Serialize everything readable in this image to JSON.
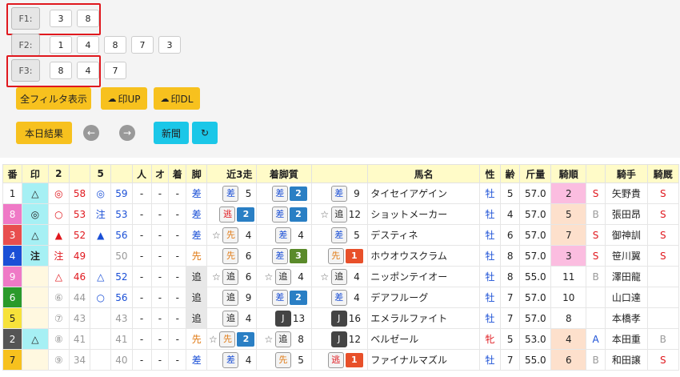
{
  "filters": [
    {
      "label": "F1:",
      "nums": [
        "3",
        "8"
      ]
    },
    {
      "label": "F2:",
      "nums": [
        "1",
        "4",
        "8",
        "7",
        "3"
      ]
    },
    {
      "label": "F3:",
      "nums": [
        "8",
        "4",
        "7"
      ]
    }
  ],
  "buttons": {
    "all_filter": "全フィルタ表示",
    "mark_up": "印UP",
    "mark_dl": "印DL",
    "today": "本日結果",
    "prev": "←",
    "next": "→",
    "paper": "新聞",
    "refresh": "↻"
  },
  "columns": [
    "番",
    "印",
    "2",
    "",
    "5",
    "",
    "人",
    "オ",
    "着",
    "脚",
    "近3走",
    "着脚質",
    "",
    "馬名",
    "性",
    "齢",
    "斤量",
    "騎順",
    "",
    "騎手",
    "騎厩"
  ],
  "rows": [
    {
      "num": "1",
      "numbg": "#ffffff",
      "numfg": "#222",
      "mark": "△",
      "markbg": "#a6f0f4",
      "m2": "◎",
      "m2c": "red",
      "v2": "58",
      "v2c": "red",
      "m5": "◎",
      "m5c": "blue",
      "v5": "59",
      "v5c": "blue",
      "ninki": "-",
      "odds": "-",
      "chaku": "-",
      "kyaku": "差",
      "kyc": "blue",
      "kybg": "",
      "races": [
        {
          "s": "",
          "k": "差",
          "n": "5",
          "b": ""
        },
        {
          "s": "",
          "k": "差",
          "n": "2",
          "b": "#2a7fc4"
        },
        {
          "s": "",
          "k": "差",
          "n": "9",
          "b": ""
        }
      ],
      "name": "タイセイアゲイン",
      "sex": "牡",
      "sexc": "blue",
      "age": "5",
      "weight": "57.0",
      "jorder": "2",
      "jobg": "#fbbde0",
      "jmark": "S",
      "jmc": "red",
      "jockey": "矢野貴",
      "jk": "S",
      "jkc": "red"
    },
    {
      "num": "8",
      "numbg": "#ef79c6",
      "numfg": "#fff",
      "mark": "◎",
      "markbg": "#a6f0f4",
      "m2": "○",
      "m2c": "red",
      "v2": "53",
      "v2c": "red",
      "m5": "注",
      "m5c": "blue",
      "v5": "53",
      "v5c": "blue",
      "ninki": "-",
      "odds": "-",
      "chaku": "-",
      "kyaku": "差",
      "kyc": "blue",
      "kybg": "",
      "races": [
        {
          "s": "",
          "k": "逃",
          "n": "2",
          "b": "#2a7fc4",
          "kc": "red"
        },
        {
          "s": "",
          "k": "差",
          "n": "2",
          "b": "#2a7fc4"
        },
        {
          "s": "☆",
          "k": "追",
          "n": "12",
          "b": ""
        }
      ],
      "name": "ショットメーカー",
      "sex": "牡",
      "sexc": "blue",
      "age": "4",
      "weight": "57.0",
      "jorder": "5",
      "jobg": "#fde0cc",
      "jmark": "B",
      "jmc": "gray",
      "jockey": "張田昂",
      "jk": "S",
      "jkc": "red"
    },
    {
      "num": "3",
      "numbg": "#e84e4e",
      "numfg": "#fff",
      "mark": "△",
      "markbg": "#a6f0f4",
      "m2": "▲",
      "m2c": "red",
      "v2": "52",
      "v2c": "red",
      "m5": "▲",
      "m5c": "blue",
      "v5": "56",
      "v5c": "blue",
      "ninki": "-",
      "odds": "-",
      "chaku": "-",
      "kyaku": "差",
      "kyc": "blue",
      "kybg": "",
      "races": [
        {
          "s": "☆",
          "k": "先",
          "n": "4",
          "b": "",
          "kc": "org"
        },
        {
          "s": "",
          "k": "差",
          "n": "4",
          "b": ""
        },
        {
          "s": "",
          "k": "差",
          "n": "5",
          "b": ""
        }
      ],
      "name": "デスティネ",
      "sex": "牡",
      "sexc": "blue",
      "age": "6",
      "weight": "57.0",
      "jorder": "7",
      "jobg": "#fde0cc",
      "jmark": "S",
      "jmc": "red",
      "jockey": "御神訓",
      "jk": "S",
      "jkc": "red"
    },
    {
      "num": "4",
      "numbg": "#1a4fd6",
      "numfg": "#fff",
      "mark": "注",
      "markbg": "#a6f0f4",
      "m2": "注",
      "m2c": "red",
      "v2": "49",
      "v2c": "red",
      "m5": "",
      "m5c": "gray",
      "v5": "50",
      "v5c": "gray",
      "ninki": "-",
      "odds": "-",
      "chaku": "-",
      "kyaku": "先",
      "kyc": "org",
      "kybg": "",
      "races": [
        {
          "s": "",
          "k": "先",
          "n": "6",
          "b": "",
          "kc": "org"
        },
        {
          "s": "",
          "k": "差",
          "n": "3",
          "b": "#5a8a2a"
        },
        {
          "s": "",
          "k": "先",
          "n": "1",
          "b": "#e8502a",
          "kc": "org"
        }
      ],
      "name": "ホウオウスクラム",
      "sex": "牡",
      "sexc": "blue",
      "age": "8",
      "weight": "57.0",
      "jorder": "3",
      "jobg": "#fbbde0",
      "jmark": "S",
      "jmc": "red",
      "jockey": "笹川翼",
      "jk": "S",
      "jkc": "red"
    },
    {
      "num": "9",
      "numbg": "#ef79c6",
      "numfg": "#fff",
      "mark": "",
      "markbg": "#fff8e0",
      "m2": "△",
      "m2c": "red",
      "v2": "46",
      "v2c": "red",
      "m5": "△",
      "m5c": "blue",
      "v5": "52",
      "v5c": "blue",
      "ninki": "-",
      "odds": "-",
      "chaku": "-",
      "kyaku": "追",
      "kyc": "#222",
      "kybg": "#e8e8e8",
      "races": [
        {
          "s": "☆",
          "k": "追",
          "n": "6",
          "b": ""
        },
        {
          "s": "☆",
          "k": "追",
          "n": "4",
          "b": ""
        },
        {
          "s": "☆",
          "k": "追",
          "n": "4",
          "b": ""
        }
      ],
      "name": "ニッポンテイオー",
      "sex": "牡",
      "sexc": "blue",
      "age": "8",
      "weight": "55.0",
      "jorder": "11",
      "jobg": "",
      "jmark": "B",
      "jmc": "gray",
      "jockey": "澤田龍",
      "jk": "",
      "jkc": "gray"
    },
    {
      "num": "6",
      "numbg": "#2a9a2a",
      "numfg": "#fff",
      "mark": "",
      "markbg": "#fff8e0",
      "m2": "⑥",
      "m2c": "gray",
      "v2": "44",
      "v2c": "gray",
      "m5": "○",
      "m5c": "blue",
      "v5": "56",
      "v5c": "blue",
      "ninki": "-",
      "odds": "-",
      "chaku": "-",
      "kyaku": "追",
      "kyc": "#222",
      "kybg": "#e8e8e8",
      "races": [
        {
          "s": "",
          "k": "追",
          "n": "9",
          "b": ""
        },
        {
          "s": "",
          "k": "差",
          "n": "2",
          "b": "#2a7fc4"
        },
        {
          "s": "",
          "k": "差",
          "n": "4",
          "b": ""
        }
      ],
      "name": "デアフルーグ",
      "sex": "牡",
      "sexc": "blue",
      "age": "7",
      "weight": "57.0",
      "jorder": "10",
      "jobg": "",
      "jmark": "",
      "jmc": "gray",
      "jockey": "山口達",
      "jk": "",
      "jkc": "gray"
    },
    {
      "num": "5",
      "numbg": "#f7e23a",
      "numfg": "#222",
      "mark": "",
      "markbg": "#fff8e0",
      "m2": "⑦",
      "m2c": "gray",
      "v2": "43",
      "v2c": "gray",
      "m5": "",
      "m5c": "gray",
      "v5": "43",
      "v5c": "gray",
      "ninki": "-",
      "odds": "-",
      "chaku": "-",
      "kyaku": "追",
      "kyc": "#222",
      "kybg": "#e8e8e8",
      "races": [
        {
          "s": "",
          "k": "追",
          "n": "4",
          "b": ""
        },
        {
          "s": "",
          "k": "J",
          "n": "13",
          "b": "",
          "dark": "1"
        },
        {
          "s": "",
          "k": "J",
          "n": "16",
          "b": "",
          "dark": "1"
        }
      ],
      "name": "エメラルファイト",
      "sex": "牡",
      "sexc": "blue",
      "age": "7",
      "weight": "57.0",
      "jorder": "8",
      "jobg": "",
      "jmark": "",
      "jmc": "gray",
      "jockey": "本橋孝",
      "jk": "",
      "jkc": "gray"
    },
    {
      "num": "2",
      "numbg": "#555555",
      "numfg": "#fff",
      "mark": "△",
      "markbg": "#a6f0f4",
      "m2": "⑧",
      "m2c": "gray",
      "v2": "41",
      "v2c": "gray",
      "m5": "",
      "m5c": "gray",
      "v5": "41",
      "v5c": "gray",
      "ninki": "-",
      "odds": "-",
      "chaku": "-",
      "kyaku": "先",
      "kyc": "org",
      "kybg": "",
      "races": [
        {
          "s": "☆",
          "k": "先",
          "n": "2",
          "b": "#2a7fc4",
          "kc": "org"
        },
        {
          "s": "☆",
          "k": "追",
          "n": "8",
          "b": ""
        },
        {
          "s": "",
          "k": "J",
          "n": "12",
          "b": "",
          "dark": "1"
        }
      ],
      "name": "ベルゼール",
      "sex": "牝",
      "sexc": "red",
      "age": "5",
      "weight": "53.0",
      "jorder": "4",
      "jobg": "#fde0cc",
      "jmark": "A",
      "jmc": "blue",
      "jockey": "本田重",
      "jk": "B",
      "jkc": "gray"
    },
    {
      "num": "7",
      "numbg": "#f7c11e",
      "numfg": "#222",
      "mark": "",
      "markbg": "#fff8e0",
      "m2": "⑨",
      "m2c": "gray",
      "v2": "34",
      "v2c": "gray",
      "m5": "",
      "m5c": "gray",
      "v5": "40",
      "v5c": "gray",
      "ninki": "-",
      "odds": "-",
      "chaku": "-",
      "kyaku": "差",
      "kyc": "blue",
      "kybg": "",
      "races": [
        {
          "s": "",
          "k": "差",
          "n": "4",
          "b": ""
        },
        {
          "s": "",
          "k": "先",
          "n": "5",
          "b": "",
          "kc": "org"
        },
        {
          "s": "",
          "k": "逃",
          "n": "1",
          "b": "#e8502a",
          "kc": "red"
        }
      ],
      "name": "ファイナルマズル",
      "sex": "牡",
      "sexc": "blue",
      "age": "7",
      "weight": "55.0",
      "jorder": "6",
      "jobg": "#fde0cc",
      "jmark": "B",
      "jmc": "gray",
      "jockey": "和田譲",
      "jk": "S",
      "jkc": "red"
    }
  ]
}
